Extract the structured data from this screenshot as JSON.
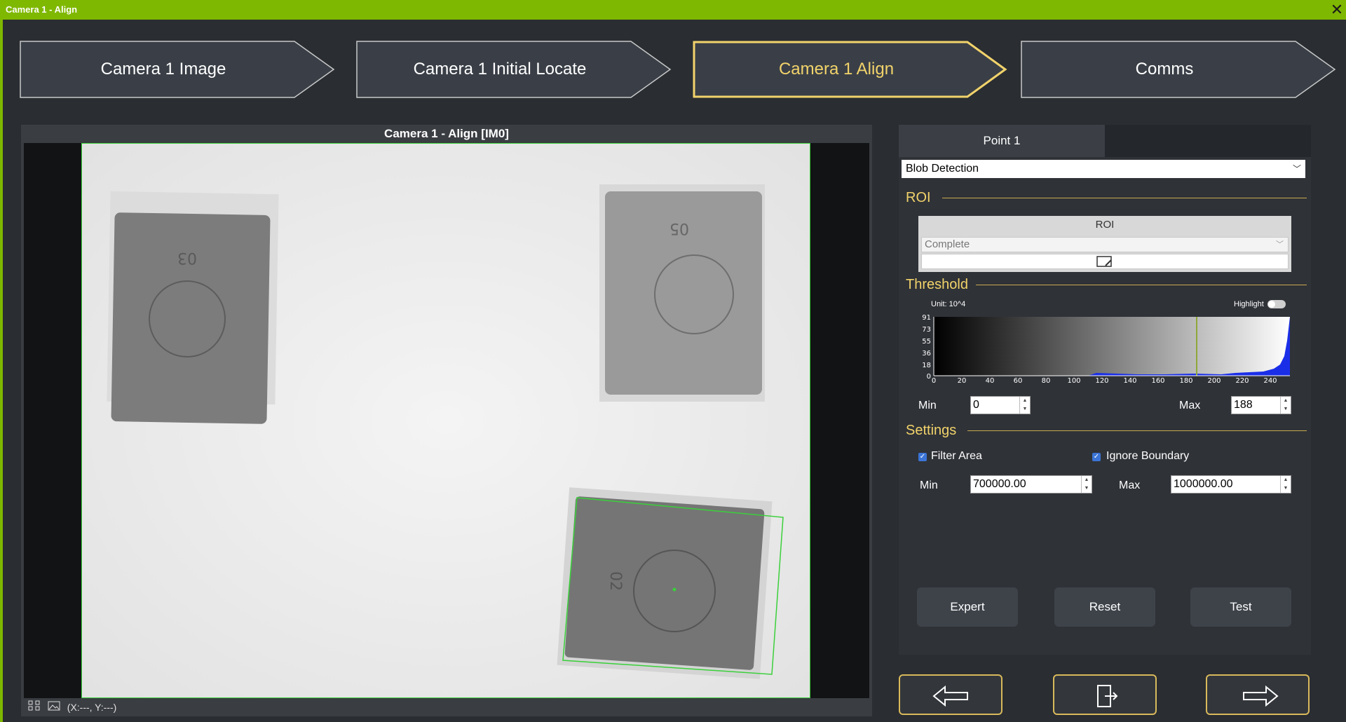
{
  "window": {
    "title": "Camera 1 - Align",
    "close_glyph": "✕"
  },
  "steps": [
    {
      "label": "Camera 1 Image",
      "active": false
    },
    {
      "label": "Camera 1 Initial Locate",
      "active": false
    },
    {
      "label": "Camera 1 Align",
      "active": true
    },
    {
      "label": "Comms",
      "active": false
    }
  ],
  "image_panel": {
    "title": "Camera 1 - Align  [IM0]",
    "coords": "(X:---, Y:---)",
    "icons": [
      "fit-view-icon",
      "image-icon"
    ]
  },
  "right_panel": {
    "tab": "Point 1",
    "method": "Blob Detection",
    "roi": {
      "section": "ROI",
      "header": "ROI",
      "mode": "Complete"
    },
    "threshold": {
      "section": "Threshold",
      "unit": "Unit: 10^4",
      "highlight_label": "Highlight",
      "y_ticks": [
        "91",
        "73",
        "55",
        "36",
        "18",
        "0"
      ],
      "x_ticks": [
        "0",
        "20",
        "40",
        "60",
        "80",
        "100",
        "120",
        "140",
        "160",
        "180",
        "200",
        "220",
        "240"
      ],
      "min_label": "Min",
      "min_value": "0",
      "max_label": "Max",
      "max_value": "188"
    },
    "settings": {
      "section": "Settings",
      "filter_area": "Filter Area",
      "ignore_boundary": "Ignore Boundary",
      "min_label": "Min",
      "min_value": "700000.00",
      "max_label": "Max",
      "max_value": "1000000.00"
    },
    "buttons": {
      "expert": "Expert",
      "reset": "Reset",
      "test": "Test"
    }
  },
  "package_labels": [
    "03",
    "05",
    "02"
  ],
  "colors": {
    "accent": "#f2d36b",
    "titlebar": "#7fb800",
    "roi_outline": "#3ad03a"
  }
}
